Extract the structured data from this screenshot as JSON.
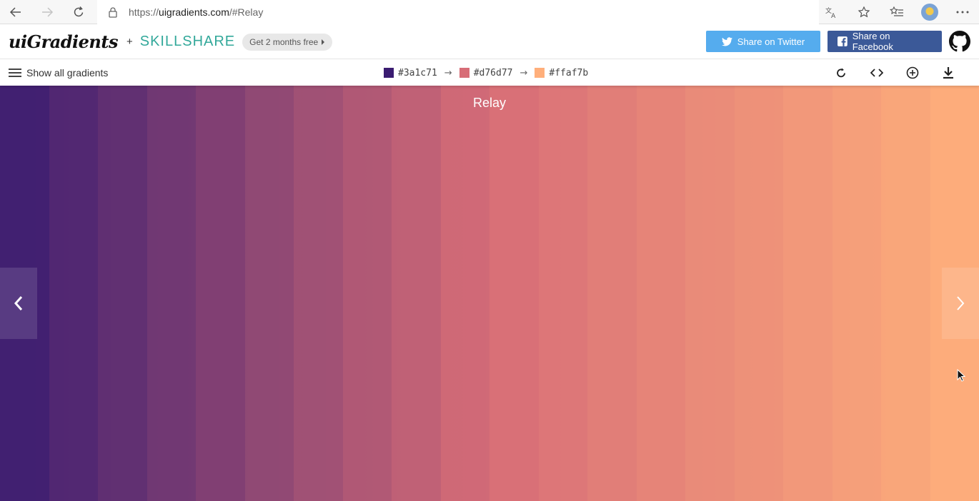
{
  "browser": {
    "url_scheme": "https://",
    "url_host": "uigradients.com",
    "url_path": "/#Relay"
  },
  "header": {
    "logo": "uiGradients",
    "plus": "+",
    "partner": "SKILLSHARE",
    "promo_label": "Get 2 months free",
    "twitter_label": "Share on Twitter",
    "facebook_label": "Share on Facebook"
  },
  "toolbar": {
    "menu_label": "Show all gradients",
    "colors": [
      "#3a1c71",
      "#d76d77",
      "#ffaf7b"
    ],
    "tools": [
      "rotate-icon",
      "code-icon",
      "add-icon",
      "download-icon"
    ]
  },
  "gradient": {
    "name": "Relay",
    "stops": [
      "#3a1c71",
      "#d76d77",
      "#ffaf7b"
    ]
  },
  "colors": {
    "twitter": "#55acee",
    "facebook": "#3b5998",
    "skillshare": "#32a89a"
  }
}
